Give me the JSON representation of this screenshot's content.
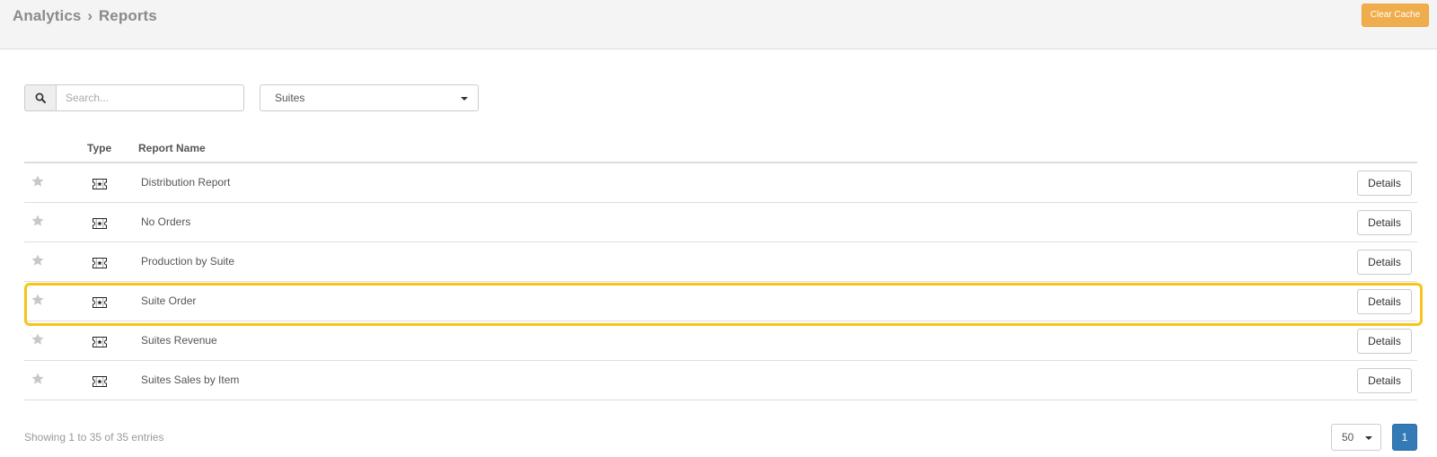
{
  "header": {
    "breadcrumb": [
      "Analytics",
      "Reports"
    ],
    "separator": "›",
    "clear_cache_label": "Clear Cache",
    "clear_cache_color": "#f0ad4e"
  },
  "search": {
    "placeholder": "Search...",
    "value": "",
    "icon": "search-icon"
  },
  "filter": {
    "selected": "Suites"
  },
  "table": {
    "columns": [
      "",
      "Type",
      "Report Name",
      ""
    ],
    "rows": [
      {
        "name": "Distribution Report",
        "type_icon": "ticket-icon",
        "action": "Details"
      },
      {
        "name": "No Orders",
        "type_icon": "ticket-icon",
        "action": "Details"
      },
      {
        "name": "Production by Suite",
        "type_icon": "ticket-icon",
        "action": "Details"
      },
      {
        "name": "Suite Order",
        "type_icon": "ticket-icon",
        "action": "Details",
        "highlighted": true
      },
      {
        "name": "Suites Revenue",
        "type_icon": "ticket-icon",
        "action": "Details"
      },
      {
        "name": "Suites Sales by Item",
        "type_icon": "ticket-icon",
        "action": "Details"
      }
    ],
    "highlight_color": "#f5c518"
  },
  "footer": {
    "info": "Showing 1 to 35 of 35 entries",
    "page_length": "50",
    "current_page": "1",
    "page_color": "#337ab7"
  }
}
